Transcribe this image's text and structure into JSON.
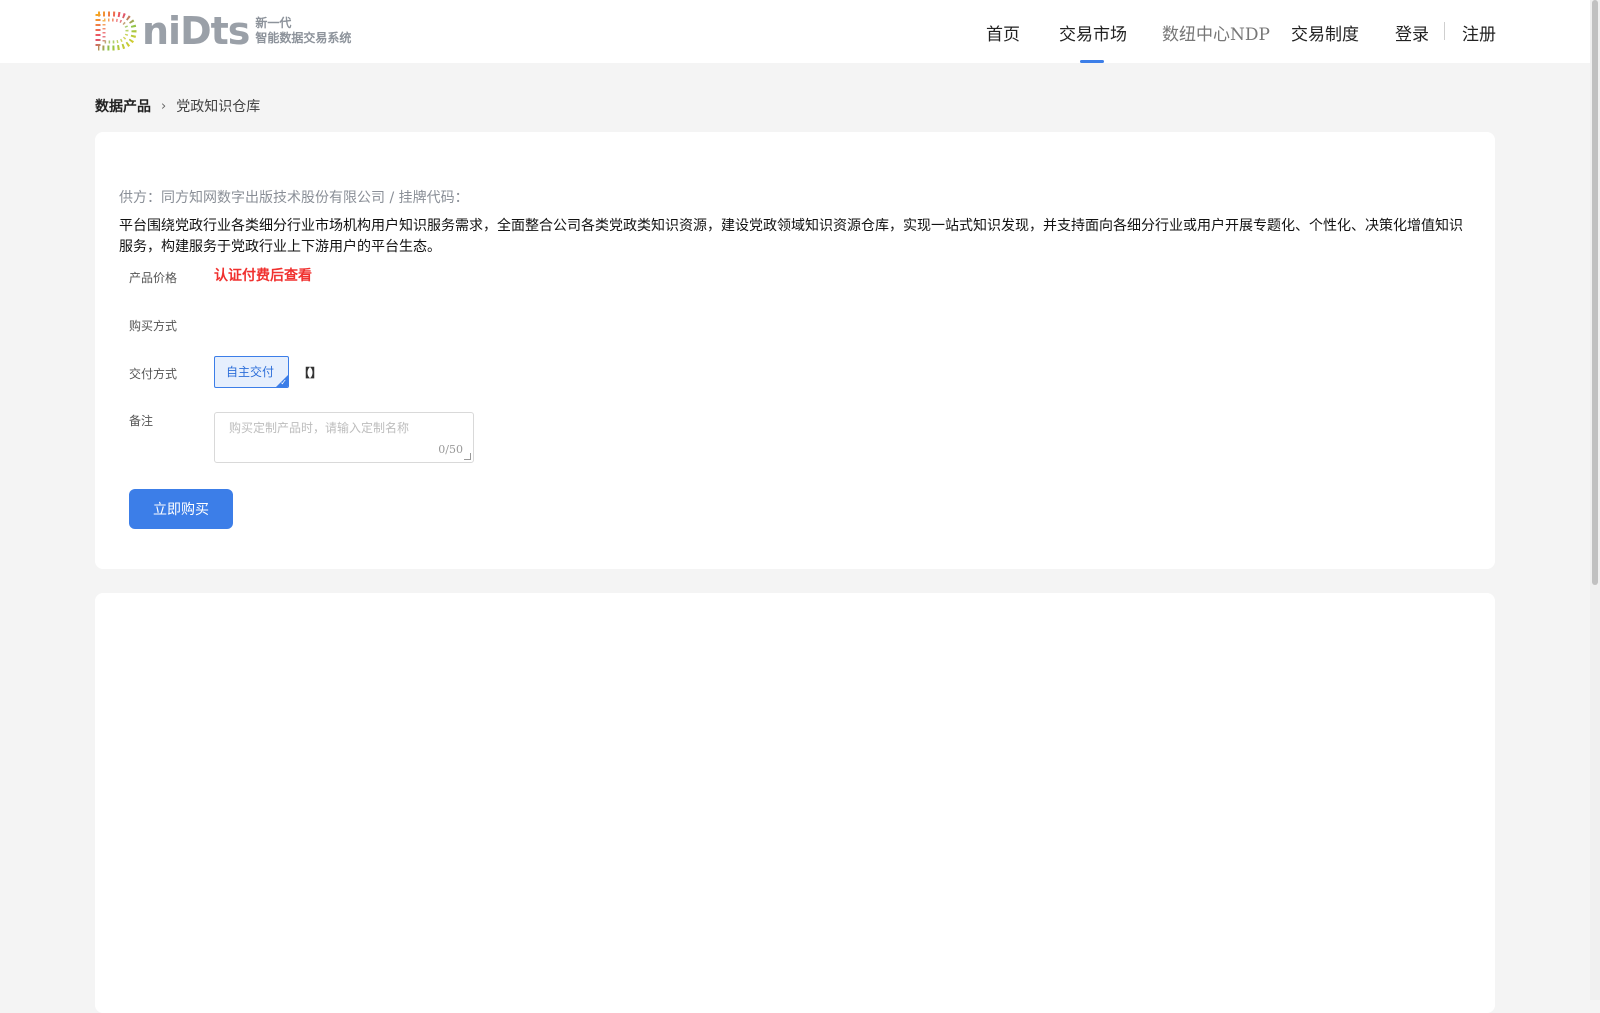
{
  "header": {
    "logo": {
      "word": "niDts",
      "subtitle_line1": "新一代",
      "subtitle_line2": "智能数据交易系统"
    },
    "nav": {
      "home": "首页",
      "market": "交易市场",
      "ndp": "数纽中心NDP",
      "rules": "交易制度",
      "login": "登录",
      "register": "注册"
    },
    "active_nav": "交易市场",
    "accent_color": "#3c7ee8"
  },
  "breadcrumb": {
    "root": "数据产品",
    "current": "党政知识仓库"
  },
  "product": {
    "supplier_line": "供方：同方知网数字出版技术股份有限公司 / 挂牌代码：",
    "description": "平台围绕党政行业各类细分行业市场机构用户知识服务需求，全面整合公司各类党政类知识资源，建设党政领域知识资源仓库，实现一站式知识发现，并支持面向各细分行业或用户开展专题化、个性化、决策化增值知识服务，构建服务于党政行业上下游用户的平台生态。",
    "fields": {
      "price_label": "产品价格",
      "price_value": "认证付费后查看",
      "purchase_label": "购买方式",
      "delivery_label": "交付方式",
      "delivery_option": "自主交付",
      "delivery_extra": "【】",
      "remark_label": "备注",
      "remark_placeholder": "购买定制产品时，请输入定制名称",
      "remark_count": "0/50"
    },
    "buy_button": "立即购买",
    "price_color": "#f0312f"
  }
}
